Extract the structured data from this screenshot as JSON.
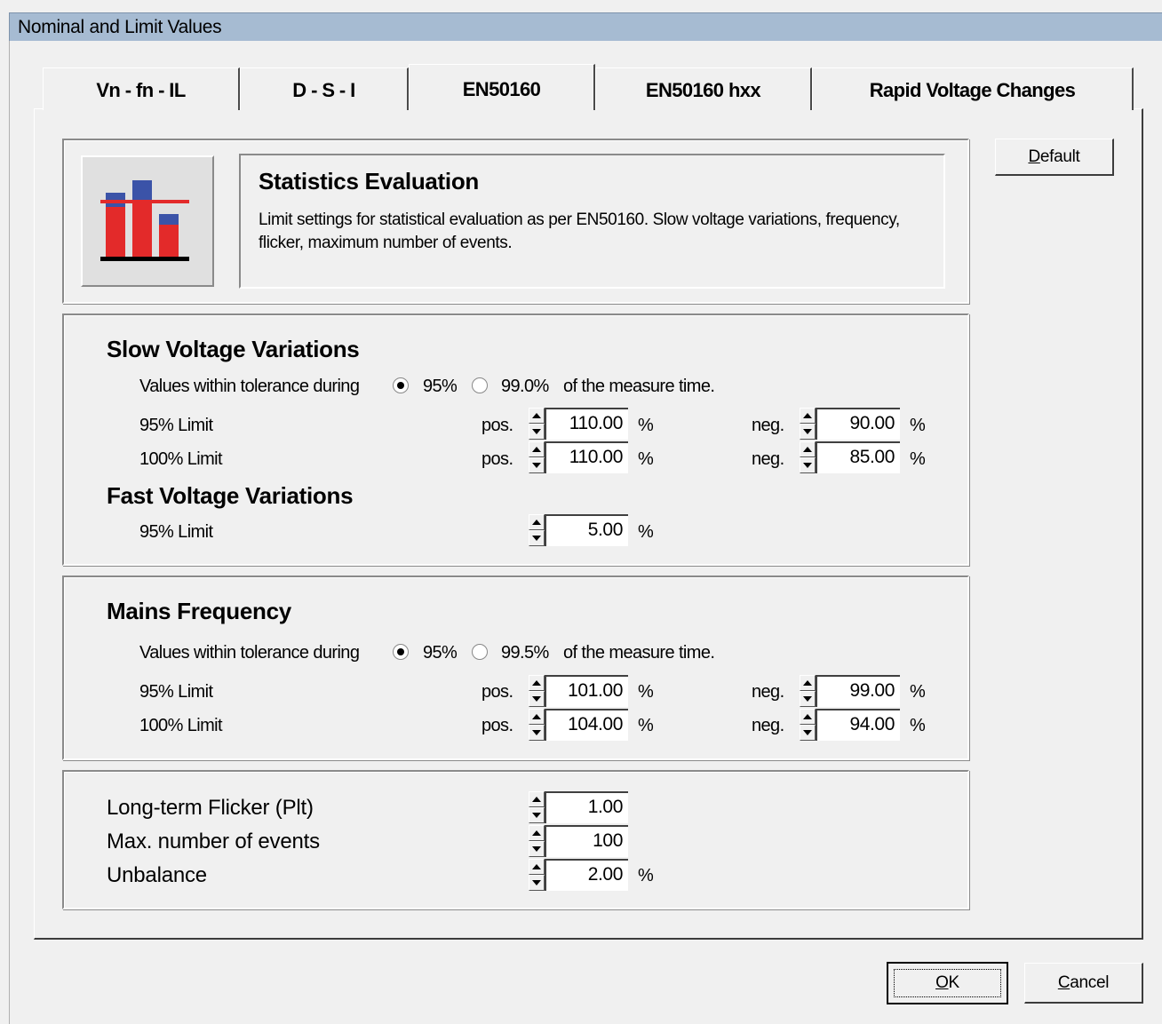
{
  "window": {
    "title": "Nominal and Limit Values"
  },
  "tabs": [
    {
      "label": "Vn - fn - IL"
    },
    {
      "label": "D - S - I"
    },
    {
      "label": "EN50160"
    },
    {
      "label": "EN50160 hxx"
    },
    {
      "label": "Rapid Voltage Changes"
    }
  ],
  "header": {
    "icon": "bar-chart-limit-icon",
    "title": "Statistics Evaluation",
    "description": "Limit settings for statistical evaluation as per EN50160. Slow voltage variations, frequency, flicker, maximum number of events."
  },
  "buttons": {
    "default_prefix": "",
    "default_ul": "D",
    "default_rest": "efault",
    "ok_ul": "O",
    "ok_rest": "K",
    "cancel_ul": "C",
    "cancel_rest": "ancel"
  },
  "common": {
    "tolerance_prefix": "Values within tolerance during",
    "tolerance_suffix": "of the measure time.",
    "pos": "pos.",
    "neg": "neg.",
    "pct": "%",
    "limit95": "95% Limit",
    "limit100": "100% Limit"
  },
  "slow_voltage": {
    "title": "Slow Voltage Variations",
    "option1": "95%",
    "option2": "99.0%",
    "selected": "95%",
    "limit95_pos": "110.00",
    "limit95_neg": "90.00",
    "limit100_pos": "110.00",
    "limit100_neg": "85.00"
  },
  "fast_voltage": {
    "title": "Fast Voltage Variations",
    "limit95": "5.00"
  },
  "mains_frequency": {
    "title": "Mains Frequency",
    "option1": "95%",
    "option2": "99.5%",
    "selected": "95%",
    "limit95_pos": "101.00",
    "limit95_neg": "99.00",
    "limit100_pos": "104.00",
    "limit100_neg": "94.00"
  },
  "misc": {
    "flicker_label": "Long-term Flicker (Plt)",
    "flicker_value": "1.00",
    "events_label": "Max. number of events",
    "events_value": "100",
    "unbalance_label": "Unbalance",
    "unbalance_value": "2.00"
  },
  "colors": {
    "titlebar": "#a6bbd2",
    "icon_red": "#e32a2a",
    "icon_blue": "#3b53a8"
  }
}
